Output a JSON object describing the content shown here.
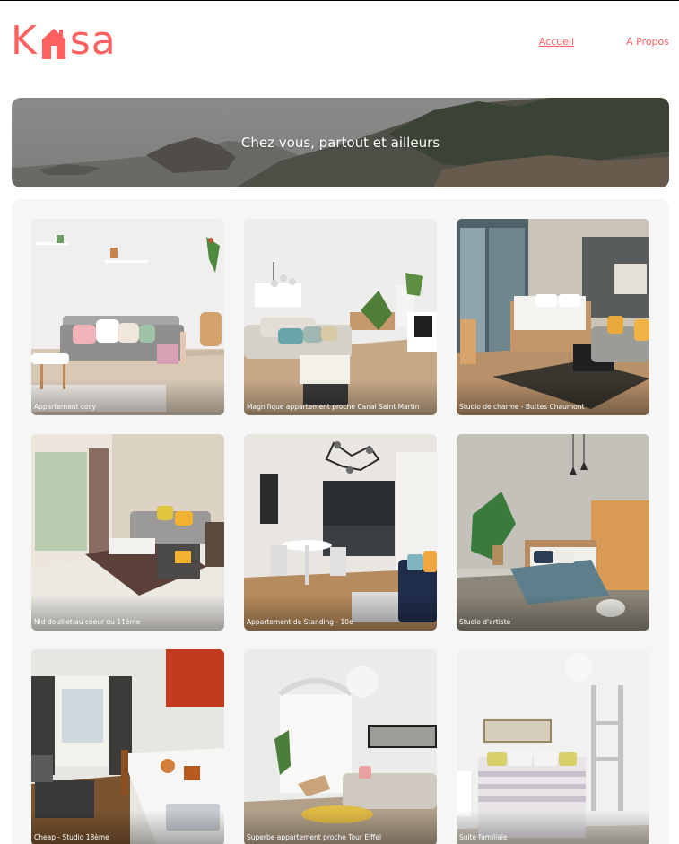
{
  "header": {
    "logo_left": "K",
    "logo_right": "sa",
    "logo_icon": "house-icon",
    "nav": [
      {
        "label": "Accueil",
        "active": true
      },
      {
        "label": "A Propos",
        "active": false
      }
    ]
  },
  "banner": {
    "title": "Chez vous, partout et ailleurs"
  },
  "listings": [
    {
      "title": "Appartement cosy"
    },
    {
      "title": "Magnifique appartement proche Canal Saint Martin"
    },
    {
      "title": "Studio de charme - Buttes Chaumont"
    },
    {
      "title": "Nid douillet au coeur du 11ème"
    },
    {
      "title": "Appartement de Standing - 10e"
    },
    {
      "title": "Studio d'artiste"
    },
    {
      "title": "Cheap - Studio 18ème"
    },
    {
      "title": "Superbe appartement proche Tour Eiffel"
    },
    {
      "title": "Suite familiale"
    }
  ],
  "colors": {
    "accent": "#ff6060",
    "gallery_bg": "#f6f6f6"
  }
}
